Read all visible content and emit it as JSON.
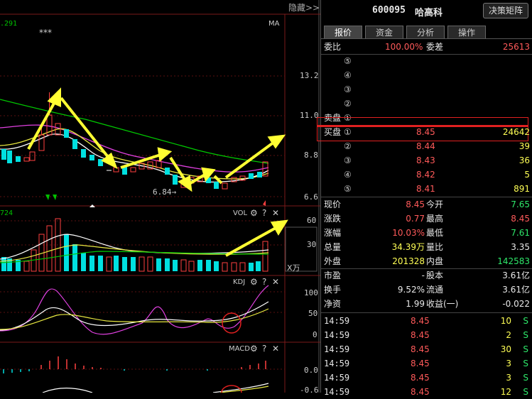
{
  "toolbar": {
    "hide_label": "隐藏>>"
  },
  "chart": {
    "ma_value": ".291",
    "stars": "***",
    "ma_label": "MA",
    "low_annotation": "6.84→",
    "price_ticks": [
      "13.2",
      "11.0",
      "8.8",
      "6.6"
    ],
    "vol_label": "VOL",
    "vol_value": "724",
    "vol_ticks": [
      "60",
      "30"
    ],
    "vol_unit": "X万",
    "kdj_label": "KDJ",
    "kdj_ticks": [
      "100",
      "50",
      "0"
    ],
    "macd_label": "MACD",
    "macd_ticks": [
      "0.0",
      "-0.6"
    ],
    "panel_icons": [
      "gear-icon",
      "help-icon",
      "close-icon"
    ],
    "colors": {
      "up": "#ff4040",
      "down": "#00e0e0",
      "ma_green": "#00c800",
      "ma_purple": "#e040e0",
      "ma_yellow": "#e8e840",
      "ma_white": "#ffffff",
      "arrow": "#ffff33"
    }
  },
  "stock": {
    "code": "600095",
    "name": "哈高科",
    "matrix_button": "决策矩阵"
  },
  "tabs": [
    "报价",
    "资金",
    "分析",
    "操作"
  ],
  "order_book": {
    "ratio_label": "委比",
    "ratio_value": "100.00%",
    "diff_label": "委差",
    "diff_value": "25613",
    "sell_label": "卖盘",
    "sell": [
      {
        "level": "⑤",
        "price": "",
        "volume": ""
      },
      {
        "level": "④",
        "price": "",
        "volume": ""
      },
      {
        "level": "③",
        "price": "",
        "volume": ""
      },
      {
        "level": "②",
        "price": "",
        "volume": ""
      },
      {
        "level": "①",
        "price": "",
        "volume": ""
      }
    ],
    "buy_label": "买盘",
    "buy": [
      {
        "level": "①",
        "price": "8.45",
        "volume": "24642"
      },
      {
        "level": "②",
        "price": "8.44",
        "volume": "39"
      },
      {
        "level": "③",
        "price": "8.43",
        "volume": "36"
      },
      {
        "level": "④",
        "price": "8.42",
        "volume": "5"
      },
      {
        "level": "⑤",
        "price": "8.41",
        "volume": "891"
      }
    ]
  },
  "quote": [
    {
      "l1": "现价",
      "v1": "8.45",
      "c1": "red",
      "l2": "今开",
      "v2": "7.65",
      "c2": "green"
    },
    {
      "l1": "涨跌",
      "v1": "0.77",
      "c1": "red",
      "l2": "最高",
      "v2": "8.45",
      "c2": "red"
    },
    {
      "l1": "涨幅",
      "v1": "10.03%",
      "c1": "red",
      "l2": "最低",
      "v2": "7.61",
      "c2": "green"
    },
    {
      "l1": "总量",
      "v1": "34.39万",
      "c1": "white",
      "l2": "量比",
      "v2": "3.35",
      "c2": "white"
    },
    {
      "l1": "外盘",
      "v1": "201328",
      "c1": "red",
      "l2": "内盘",
      "v2": "142583",
      "c2": "green"
    }
  ],
  "fundamentals": [
    {
      "l1": "市盈",
      "v1": "-",
      "l2": "股本",
      "v2": "3.61亿"
    },
    {
      "l1": "换手",
      "v1": "9.52%",
      "l2": "流通",
      "v2": "3.61亿"
    },
    {
      "l1": "净资",
      "v1": "1.99",
      "l2": "收益(一)",
      "v2": "-0.022"
    }
  ],
  "ticks": [
    {
      "time": "14:59",
      "price": "8.45",
      "vol": "10",
      "side": "S"
    },
    {
      "time": "14:59",
      "price": "8.45",
      "vol": "2",
      "side": "S"
    },
    {
      "time": "14:59",
      "price": "8.45",
      "vol": "30",
      "side": "S"
    },
    {
      "time": "14:59",
      "price": "8.45",
      "vol": "3",
      "side": "S"
    },
    {
      "time": "14:59",
      "price": "8.45",
      "vol": "3",
      "side": "S"
    },
    {
      "time": "14:59",
      "price": "8.45",
      "vol": "12",
      "side": "S"
    }
  ]
}
